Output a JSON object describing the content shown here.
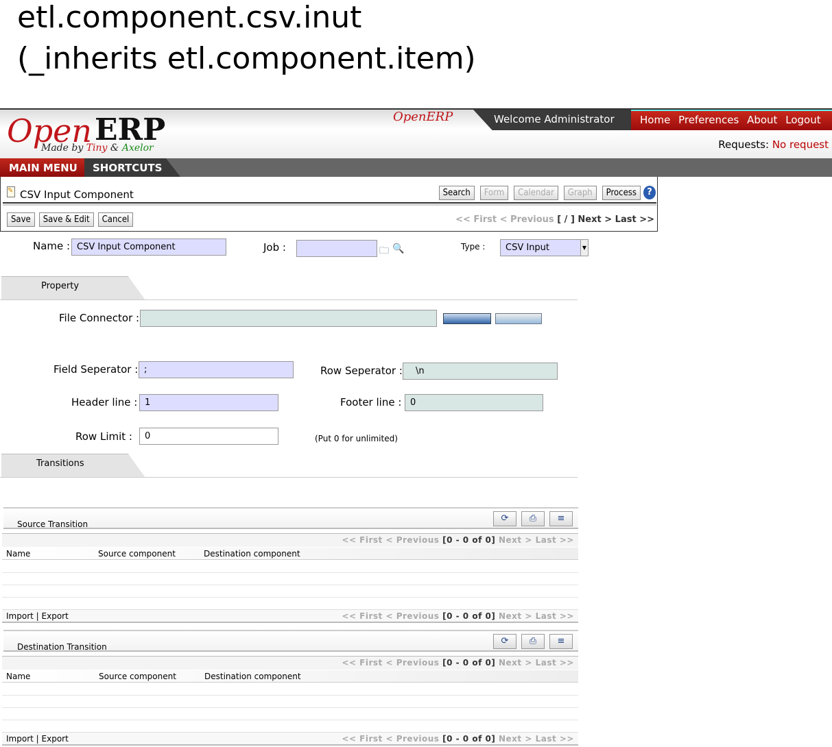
{
  "heading": {
    "line1": "etl.component.csv.inut",
    "line2": "(_inherits etl.component.item)"
  },
  "header": {
    "logo_open": "Open",
    "logo_erp": "ERP",
    "logo_sub_made": "Made by",
    "logo_sub_tiny": "Tiny",
    "logo_sub_amp": "&",
    "logo_sub_axelor": "Axelor",
    "small_logo": "OpenERP",
    "welcome": "Welcome Administrator",
    "links": [
      "Home",
      "Preferences",
      "About",
      "Logout"
    ],
    "requests_label": "Requests:",
    "requests_value": "No request"
  },
  "nav": {
    "main_menu": "MAIN MENU",
    "shortcuts": "SHORTCUTS"
  },
  "panel": {
    "title": "CSV Input Component",
    "views": [
      {
        "label": "Search",
        "enabled": true
      },
      {
        "label": "Form",
        "enabled": false
      },
      {
        "label": "Calendar",
        "enabled": false
      },
      {
        "label": "Graph",
        "enabled": false
      },
      {
        "label": "Process",
        "enabled": true
      }
    ],
    "actions": [
      "Save",
      "Save & Edit",
      "Cancel"
    ],
    "pager": {
      "first": "<< First",
      "prev": "< Previous",
      "pos": "[ / ]",
      "next": "Next >",
      "last": "Last >>"
    }
  },
  "form": {
    "name_label": "Name :",
    "name_value": "CSV Input Component",
    "job_label": "Job :",
    "job_value": "",
    "type_label": "Type :",
    "type_value": "CSV Input",
    "tab_property": "Property",
    "file_connector_label": "File Connector :",
    "file_connector_value": "",
    "field_sep_label": "Field Seperator :",
    "field_sep_value": ";",
    "row_sep_label": "Row Seperator :",
    "row_sep_value": "\\n",
    "header_label": "Header line :",
    "header_value": "1",
    "footer_label": "Footer line :",
    "footer_value": "0",
    "row_limit_label": "Row Limit :",
    "row_limit_value": "0",
    "row_limit_hint": "(Put 0 for unlimited)",
    "tab_transitions": "Transitions"
  },
  "grids": [
    {
      "title": "Source Transition",
      "columns": [
        "Name",
        "Source component",
        "Destination component"
      ],
      "pager": {
        "first": "<< First",
        "prev": "< Previous",
        "range": "[0 - 0 of 0]",
        "next": "Next >",
        "last": "Last >>"
      },
      "import": "Import",
      "sep": "|",
      "export": "Export"
    },
    {
      "title": "Destination Transition",
      "columns": [
        "Name",
        "Source component",
        "Destination component"
      ],
      "pager": {
        "first": "<< First",
        "prev": "< Previous",
        "range": "[0 - 0 of 0]",
        "next": "Next >",
        "last": "Last >>"
      },
      "import": "Import",
      "sep": "|",
      "export": "Export"
    }
  ]
}
